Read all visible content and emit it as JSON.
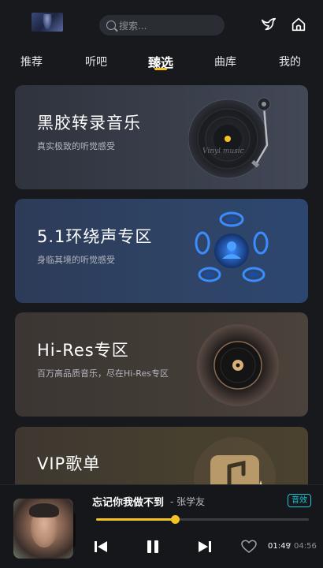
{
  "header": {
    "search_placeholder": "搜索..."
  },
  "tabs": [
    {
      "label": "推荐",
      "active": false
    },
    {
      "label": "听吧",
      "active": false
    },
    {
      "label": "臻选",
      "active": true
    },
    {
      "label": "曲库",
      "active": false
    },
    {
      "label": "我的",
      "active": false
    }
  ],
  "cards": {
    "vinyl": {
      "title": "黑胶转录音乐",
      "subtitle": "真实极致的听觉感受",
      "art_text": "Vinyl music"
    },
    "surround": {
      "title": "5.1环绕声专区",
      "subtitle": "身临其境的听觉感受"
    },
    "hires": {
      "title": "Hi-Res专区",
      "subtitle": "百万高品质音乐，尽在Hi-Res专区"
    },
    "vip": {
      "title": "VIP歌单"
    }
  },
  "player": {
    "song_title": "忘记你我做不到",
    "artist": "- 张学友",
    "badge": "音效",
    "current_time": "01:49",
    "separator": "/",
    "total_time": "04:56",
    "progress": 0.37
  },
  "colors": {
    "accent": "#f5c323",
    "badge": "#1ec4d8",
    "background": "#17191d"
  },
  "icons": {
    "search": "search-icon",
    "bird": "bird-icon",
    "home": "home-icon",
    "prev": "skip-previous-icon",
    "pause": "pause-icon",
    "next": "skip-next-icon",
    "heart": "heart-icon"
  }
}
